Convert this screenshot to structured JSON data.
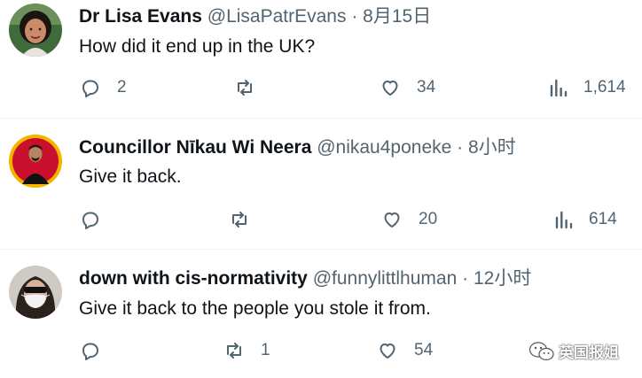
{
  "tweets": [
    {
      "name": "Dr Lisa Evans",
      "handle": "@LisaPatrEvans",
      "separator": "·",
      "time": "8月15日",
      "text": "How did it end up in the UK?",
      "replies": "2",
      "reposts": "",
      "likes": "34",
      "views": "1,614"
    },
    {
      "name": "Councillor Nīkau Wi Neera",
      "handle": "@nikau4poneke",
      "separator": "·",
      "time": "8小时",
      "text": "Give it back.",
      "replies": "",
      "reposts": "",
      "likes": "20",
      "views": "614"
    },
    {
      "name": "down with cis-normativity",
      "handle": "@funnylittlhuman",
      "separator": "·",
      "time": "12小时",
      "text": "Give it back to the people you stole it from.",
      "replies": "",
      "reposts": "1",
      "likes": "54",
      "views": ""
    }
  ],
  "watermark": {
    "text": "英国报姐"
  },
  "colors": {
    "text": "#0f1419",
    "secondary": "#536471",
    "divider": "#eff3f4",
    "avatar_ring": "#f4b400"
  }
}
